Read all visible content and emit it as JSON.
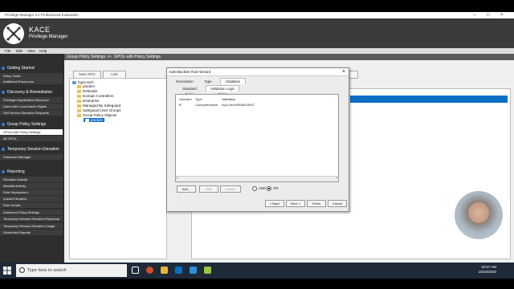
{
  "window": {
    "title": "Privilege Manager 4.x Professional Evaluation"
  },
  "header": {
    "brand": "KACE",
    "product": "Privilege Manager"
  },
  "menubar": [
    "File",
    "Edit",
    "View",
    "Help"
  ],
  "sidebar": {
    "sections": [
      {
        "label": "Getting Started",
        "items": [
          "Setup Tasks",
          "Additional Resources"
        ]
      },
      {
        "label": "Discovery & Remediation",
        "items": [
          "Privileged Application Discovery",
          "Users with Local Admin Rights",
          "Self Service Elevation Requests"
        ]
      },
      {
        "label": "Group Policy Settings",
        "items": [
          "GPOs with Policy Settings",
          "All GPOs"
        ]
      },
      {
        "label": "Temporary Session Elevation",
        "items": [
          "Passcode Manager"
        ]
      },
      {
        "label": "Reporting",
        "items": [
          "Elevation Activity",
          "Blacklist Activity",
          "Rule Deployment",
          "Instant Elevation",
          "Rule Details",
          "Advanced Policy Settings",
          "Temporary Session Elevation Requests",
          "Temporary Session Elevation Usage",
          "Scheduled Reports"
        ]
      }
    ]
  },
  "breadcrumb": {
    "part1": "Group Policy Settings",
    "sep": ">>",
    "part2": "GPOs with Policy Settings"
  },
  "toolbar": {
    "new_gpo": "New GPO",
    "link": "Link"
  },
  "tree": {
    "root": "hq2o.tech",
    "items": [
      "pmdum",
      "Defender",
      "Domain Controllers",
      "Enterprise",
      "Managed By Safeguard",
      "Safeguard User Groups",
      "Group Policy Objects"
    ],
    "selected": "pmdum"
  },
  "dialog": {
    "title": "Edit Blacklist Rule Wizard",
    "close": "×",
    "tabs": [
      "Description",
      "Type",
      "Validation Logic"
    ],
    "subtabs": [
      "Standard Rules",
      "Validation Logic Rules"
    ],
    "columns": [
      "Operator",
      "Type",
      "Validation"
    ],
    "rows": [
      {
        "operator": "IF",
        "type": "ComputerName",
        "validation": "hq2o.tech\\PAMAGENT"
      }
    ],
    "buttons": {
      "add": "Add...",
      "edit": "Edit",
      "delete": "Delete"
    },
    "radio": {
      "and": "AND",
      "or": "OR",
      "selected": "OR"
    },
    "footer": {
      "back": "< Back",
      "next": "Next >",
      "finish": "Finish",
      "cancel": "Cancel"
    }
  },
  "taskbar": {
    "search_placeholder": "Type here to search",
    "time": "10:57 AM",
    "date": "10/16/2020"
  },
  "colors": {
    "accent": "#0a6ec4",
    "sidebar": "#2e2e2e",
    "header": "#3a3a3a"
  }
}
